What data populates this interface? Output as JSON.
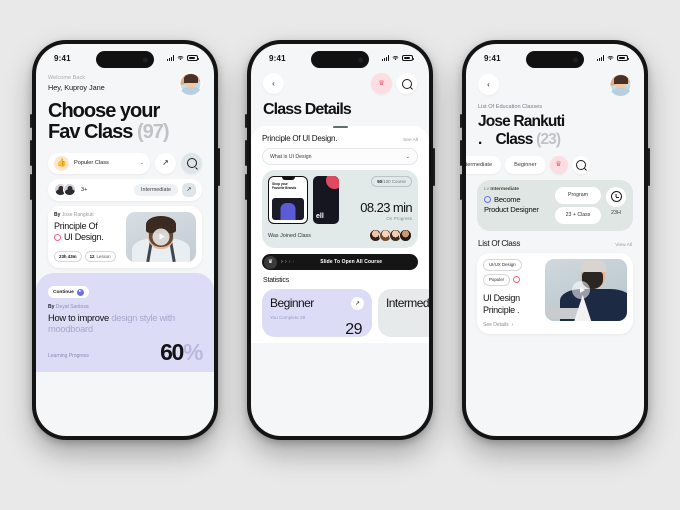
{
  "phone1": {
    "status": {
      "time": "9:41"
    },
    "header": {
      "welcome": "Welcome Back",
      "greeting": "Hey, Kuproy Jane"
    },
    "title": {
      "line1": "Choose your",
      "line2": "Fav Class",
      "count": "(97)"
    },
    "filters": {
      "popular_label": "Populer Class",
      "thumb_icon": "thumbs-up-icon",
      "chevron": "⌄",
      "share_icon": "↗",
      "search_icon": "search-icon"
    },
    "row2": {
      "avatars_more": "3+",
      "level": "Intermediate",
      "arrow": "↗"
    },
    "course_card": {
      "by_prefix": "By",
      "by_name": "Jose Rangkuti",
      "title_line1": "Principle Of",
      "title_line2": "UI Design.",
      "badge_duration_value": "23h 43m",
      "badge_duration_unit": "",
      "badge_lessons_value": "12",
      "badge_lessons_unit": "Lesson",
      "play_icon": "play-icon"
    },
    "continue_card": {
      "chip": "Continue",
      "by_prefix": "By",
      "by_name": "Deyat Santosa",
      "headline_strong": "How to improve",
      "headline_faded": " design style with moodboard",
      "progress_label": "Learning Progress",
      "progress_value": "60",
      "progress_unit": "%"
    }
  },
  "phone2": {
    "status": {
      "time": "9:41"
    },
    "nav": {
      "back_icon": "‹",
      "crown_icon": "♛",
      "search_icon": "search-icon"
    },
    "title": "Class Details",
    "sheet": {
      "heading": "Principle Of UI Design.",
      "see_all": "See All",
      "select_value": "What is UI Design",
      "select_chevron": "⌄"
    },
    "progress_card": {
      "course_badge_done": "50",
      "course_badge_rest": "/100 Course",
      "time": "08.23 min",
      "status": "On Progress",
      "joined": "Was Joined Class"
    },
    "slide": {
      "label": "Slide To Open All Course",
      "cart_icon": "♛"
    },
    "statistics": {
      "heading": "Statistics",
      "cards": [
        {
          "name": "Beginner",
          "complete_label": "You Complete 29",
          "number": "29",
          "arrow": "↗"
        },
        {
          "name": "Intermediate",
          "complete_label": "",
          "number": "",
          "arrow": "↗"
        }
      ]
    }
  },
  "phone3": {
    "status": {
      "time": "9:41"
    },
    "nav": {
      "back_icon": "‹"
    },
    "subtitle": "List Of Education Classes",
    "title": {
      "line1": "Jose Rankuti",
      "dot": ".",
      "line2": "Class",
      "count": "(23)"
    },
    "chips": [
      {
        "label": "Intermediate",
        "type": "text"
      },
      {
        "label": "Beginner",
        "type": "text"
      },
      {
        "label": "crown-icon",
        "type": "crown"
      },
      {
        "label": "search-icon",
        "type": "search"
      }
    ],
    "program_card": {
      "level_prefix": "Lv",
      "level": "Intermediate",
      "goal_line1": "Become",
      "goal_line2": "Product Designer",
      "box1": "Program",
      "box2": "23 + Class",
      "hours": "23H",
      "clock_icon": "clock-icon"
    },
    "list": {
      "heading": "List Of Class",
      "view_all": "View All"
    },
    "class_card": {
      "tag1": "UI/UX Design",
      "tag2": "Populer",
      "title_line1": "UI Design",
      "title_line2": "Principle .",
      "see_details": "See Details",
      "see_details_arrow": "›",
      "play_icon": "play-icon"
    }
  }
}
